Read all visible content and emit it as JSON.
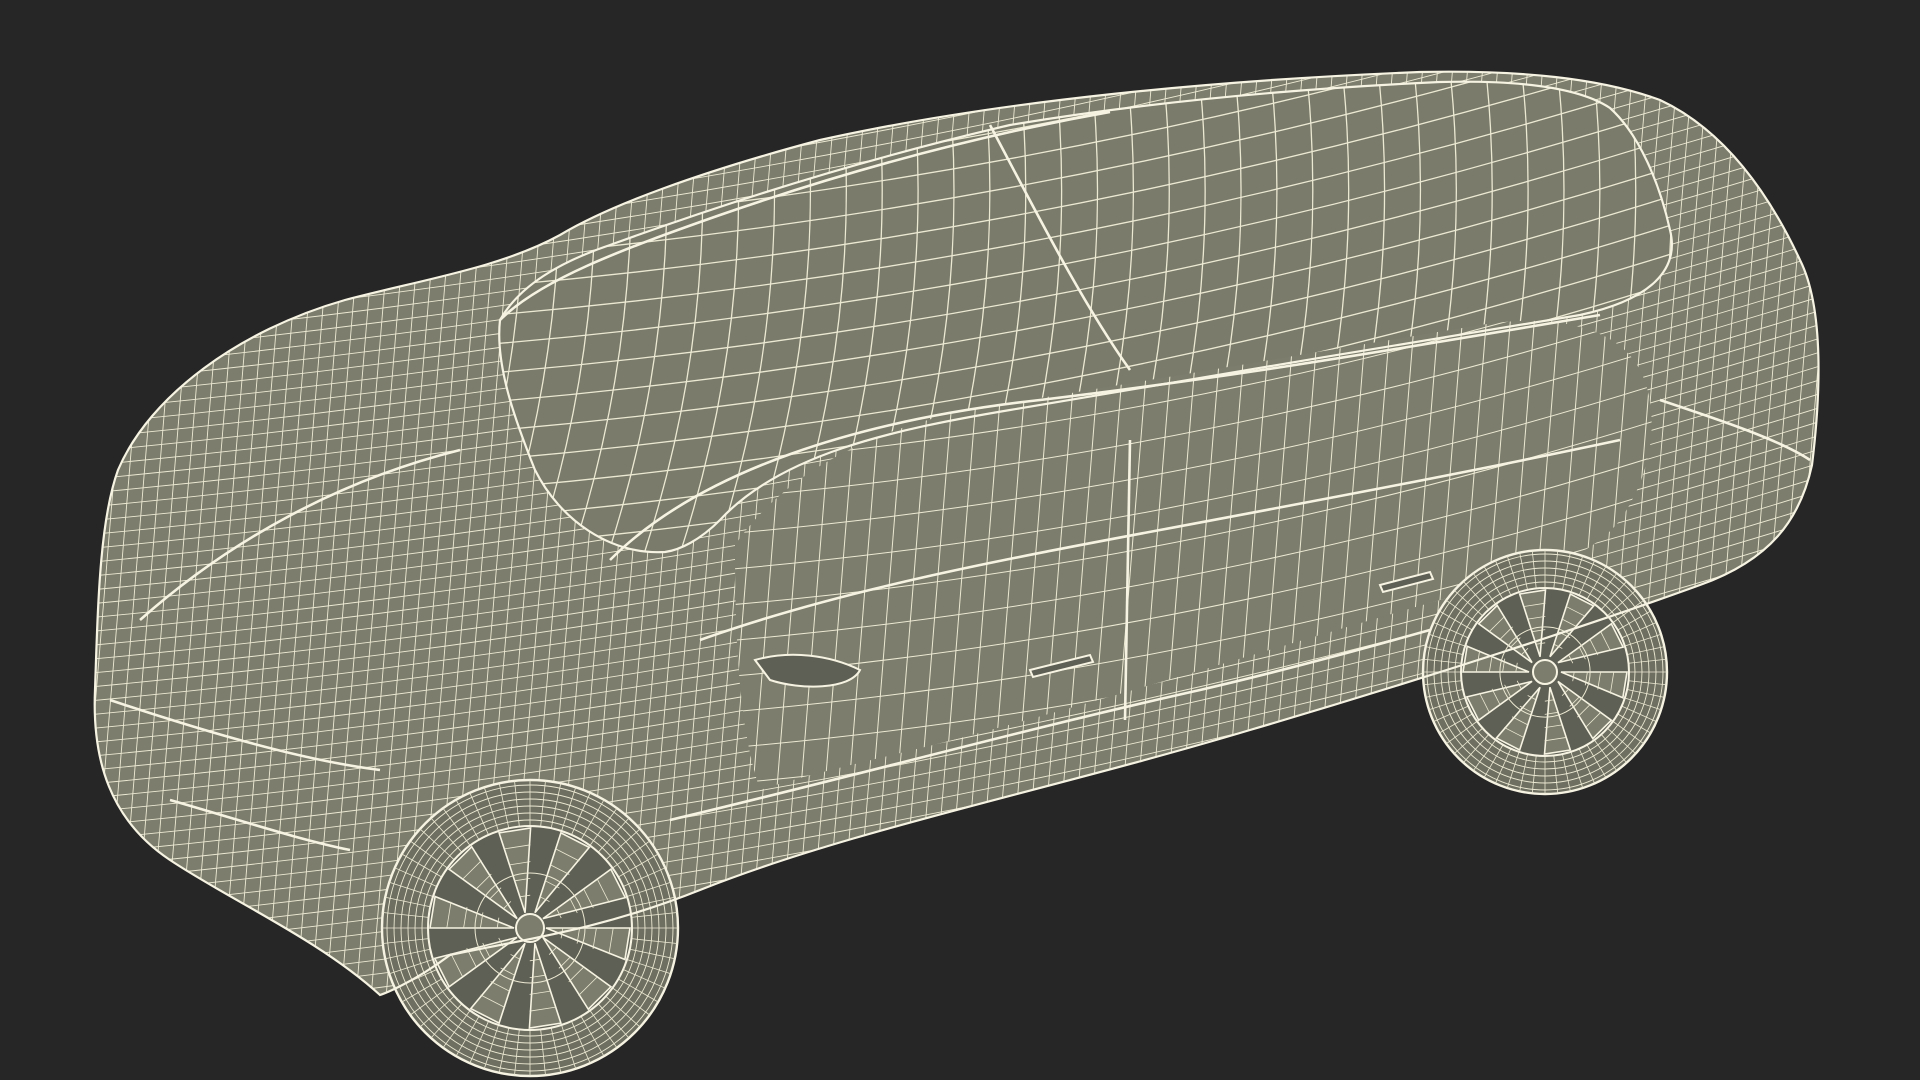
{
  "scene": {
    "background": "#262626",
    "body_fill": "#7c7d6d",
    "glass_fill": "#7a7b6b",
    "shadow_fill": "#5f6055",
    "wire_color": "#ece9d3",
    "wire_strong": "#f6f3e2",
    "tire_fill": "#6e6f61",
    "subject": "car-wireframe"
  }
}
